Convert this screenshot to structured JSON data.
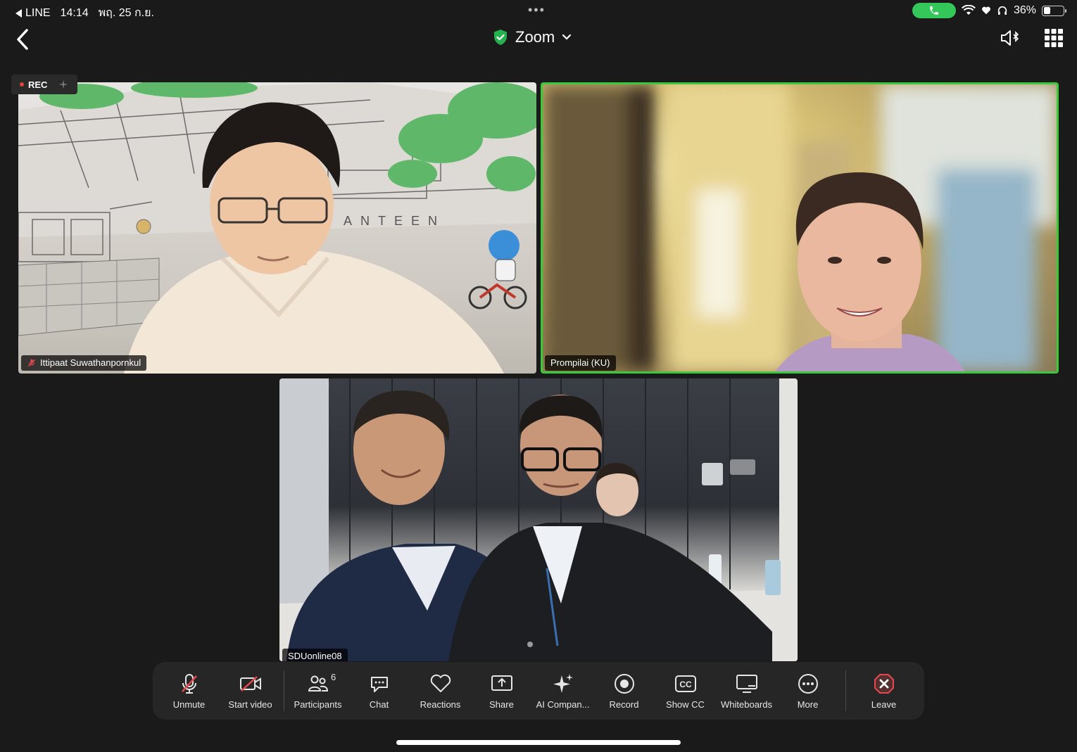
{
  "status_bar": {
    "back_app": "LINE",
    "time": "14:14",
    "date": "พฤ. 25 ก.ย.",
    "battery": "36%"
  },
  "header": {
    "title": "Zoom"
  },
  "recording": {
    "label": "REC"
  },
  "participants_tiles": [
    {
      "name": "Ittipaat Suwathanpornkul",
      "muted": true
    },
    {
      "name": "Prompilai (KU)",
      "active_speaker": true
    },
    {
      "name": "SDUonline08"
    }
  ],
  "toolbar": {
    "unmute": "Unmute",
    "start_video": "Start video",
    "participants": "Participants",
    "participants_count": "6",
    "chat": "Chat",
    "reactions": "Reactions",
    "share": "Share",
    "ai_companion": "AI Compan...",
    "record": "Record",
    "show_cc": "Show CC",
    "whiteboards": "Whiteboards",
    "more": "More",
    "leave": "Leave"
  },
  "colors": {
    "background": "#1a1a1a",
    "toolbar_bg": "#262626",
    "active_speaker_border": "#3ac93a",
    "call_pill": "#34c759",
    "leave_red": "#e5484d",
    "shield_green": "#23b14d"
  }
}
